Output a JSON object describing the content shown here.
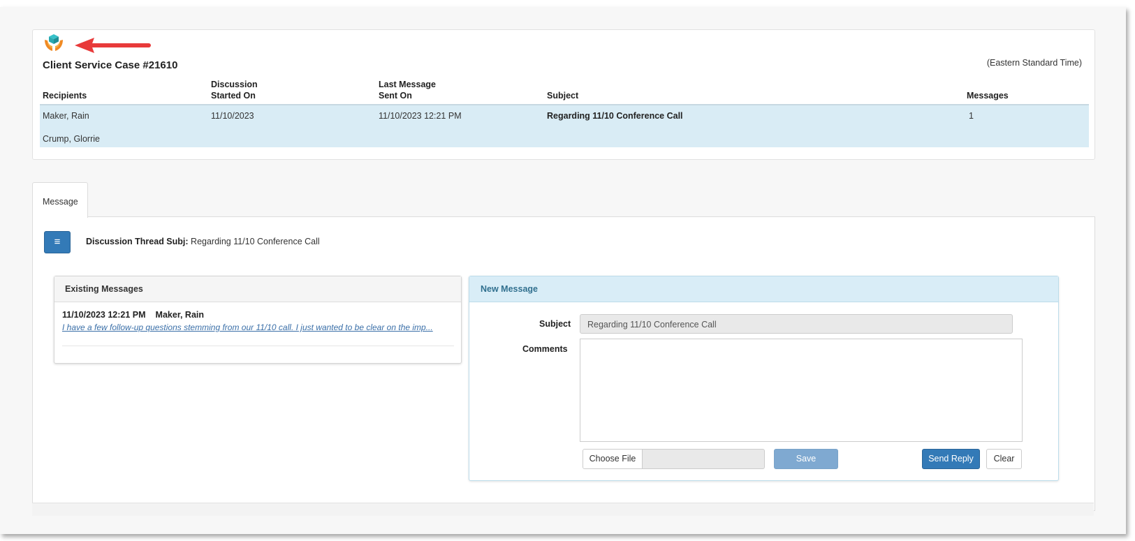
{
  "case": {
    "title": "Client Service Case #21610",
    "timezone": "(Eastern Standard Time)",
    "columns": {
      "recipients": "Recipients",
      "discussion_started_on": "Discussion\nStarted On",
      "last_message_sent_on": "Last Message\nSent On",
      "subject": "Subject",
      "messages": "Messages"
    },
    "row": {
      "recipients": [
        "Maker, Rain",
        "Crump, Glorrie"
      ],
      "started_on": "11/10/2023",
      "last_sent": "11/10/2023 12:21 PM",
      "subject": "Regarding 11/10 Conference Call",
      "messages": "1"
    }
  },
  "tabs": [
    {
      "label": "Message"
    }
  ],
  "thread": {
    "menu_icon": "≡",
    "subject_label": "Discussion Thread Subj:",
    "subject_value": "Regarding 11/10 Conference Call"
  },
  "existing_messages": {
    "title": "Existing Messages",
    "items": [
      {
        "datetime": "11/10/2023 12:21 PM",
        "author": "Maker, Rain",
        "preview": "I have a few follow-up questions stemming from our 11/10 call. I just wanted to be clear on the imp..."
      }
    ]
  },
  "new_message": {
    "title": "New Message",
    "subject_label": "Subject",
    "subject_value": "Regarding 11/10 Conference Call",
    "comments_label": "Comments",
    "comments_value": "",
    "choose_file_label": "Choose File",
    "save_label": "Save",
    "send_reply_label": "Send Reply",
    "clear_label": "Clear"
  },
  "colors": {
    "primary": "#337ab7",
    "row_highlight": "#d9ecf5",
    "new_message_header": "#d9edf7",
    "annotation_arrow": "#e83a3a"
  },
  "icons": {
    "logo": "hands-holding-box-icon",
    "annotation": "red-arrow-left-icon",
    "menu": "hamburger-menu-icon",
    "resize": "resize-grip-icon"
  }
}
